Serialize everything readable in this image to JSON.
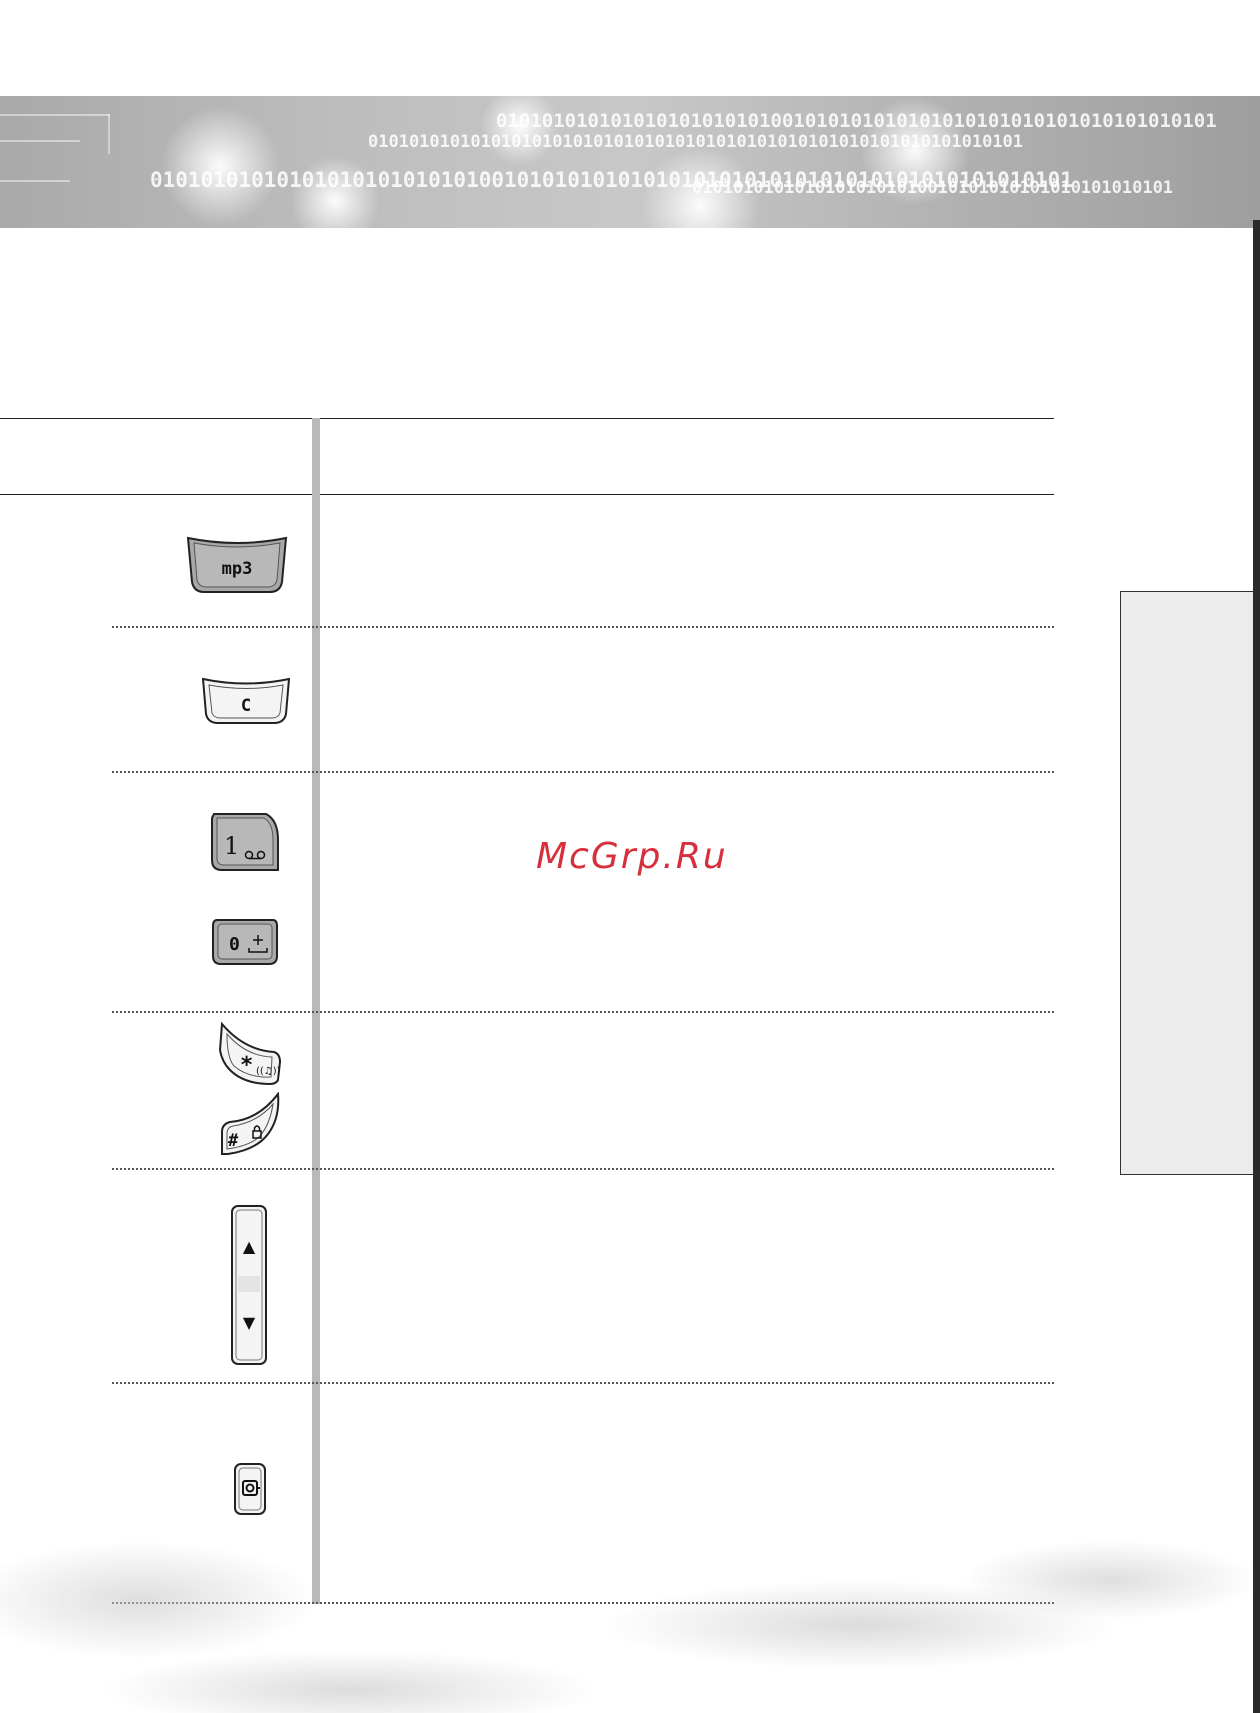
{
  "header": {
    "binary_lines": [
      "010101010101010101010101001010101010101010101010101010101010101",
      "0101010101010101010101010101010101010101010101010101010101010101",
      "0101010101010101010101010100101010101010101010101010101010101010101010101",
      "01010101010101010101010010101010101010101010101"
    ]
  },
  "watermark": {
    "text": "McGrp.Ru",
    "color": "#d6303c"
  },
  "keys": {
    "mp3": {
      "label": "mp3",
      "icon": "mp3-key-icon"
    },
    "clear": {
      "label": "C",
      "icon": "clear-key-icon"
    },
    "one": {
      "label": "1",
      "icon": "voicemail-key-icon"
    },
    "zero": {
      "label": "0",
      "icon": "zero-plus-key-icon"
    },
    "star": {
      "label": "*",
      "icon": "star-vibrate-key-icon"
    },
    "hash": {
      "label": "#",
      "icon": "hash-lock-key-icon"
    },
    "volume": {
      "up": "▲",
      "down": "▼",
      "icon": "volume-side-key-icon"
    },
    "camera": {
      "icon": "camera-side-key-icon"
    }
  },
  "colors": {
    "key_fill_dark": "#a8a8a8",
    "key_fill_light": "#f4f4f4",
    "side_tab": "#ececec"
  }
}
